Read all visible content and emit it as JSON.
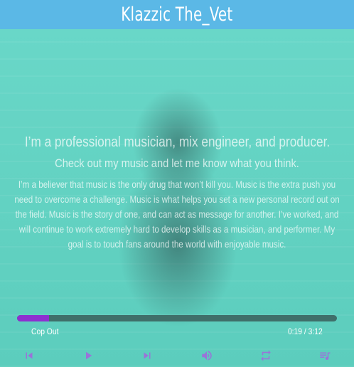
{
  "header": {
    "title": "Klazzic The_Vet"
  },
  "content": {
    "headline": "I’m a professional musician, mix engineer, and producer.",
    "subline": "Check out my music and let me know what you think.",
    "bio": "I’m a believer that music is the only drug that won’t kill you. Music is the extra push you need to overcome a challenge. Music is what helps you set a new personal record out on the field. Music is the story of one, and can act as message for another. I’ve worked, and will continue to work extremely hard to develop skills as a musician, and performer. My goal is to touch fans around the world with enjoyable music."
  },
  "player": {
    "track_name": "Cop Out",
    "time": "0:19 / 3:12",
    "progress": 0.099,
    "accent_color": "#8e2fd0",
    "icon_color": "#9a73d9",
    "controls": [
      "previous-icon",
      "play-icon",
      "next-icon",
      "volume-icon",
      "repeat-icon",
      "playlist-icon"
    ]
  }
}
